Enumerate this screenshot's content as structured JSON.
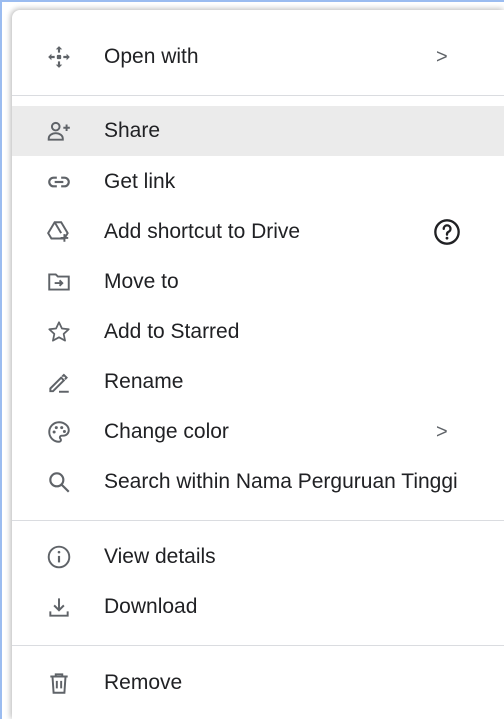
{
  "menu": {
    "items": [
      {
        "label": "Open with",
        "icon": "open-with-icon",
        "submenu_indicator": ">"
      },
      {
        "label": "Share",
        "icon": "person-add-icon"
      },
      {
        "label": "Get link",
        "icon": "link-icon"
      },
      {
        "label": "Add shortcut to Drive",
        "icon": "add-shortcut-icon",
        "help_icon": "help-icon"
      },
      {
        "label": "Move to",
        "icon": "move-to-folder-icon"
      },
      {
        "label": "Add to Starred",
        "icon": "star-icon"
      },
      {
        "label": "Rename",
        "icon": "rename-pencil-icon"
      },
      {
        "label": "Change color",
        "icon": "palette-icon",
        "submenu_indicator": ">"
      },
      {
        "label": "Search within Nama Perguruan Tinggi",
        "icon": "search-icon"
      },
      {
        "label": "View details",
        "icon": "info-icon"
      },
      {
        "label": "Download",
        "icon": "download-icon"
      },
      {
        "label": "Remove",
        "icon": "trash-icon"
      }
    ],
    "highlighted_item": "Share"
  },
  "colors": {
    "text": "#202124",
    "icon": "#5f6368",
    "hover_background": "#ebebeb",
    "divider": "#dadce0",
    "window_border": "#9bbcf0"
  }
}
